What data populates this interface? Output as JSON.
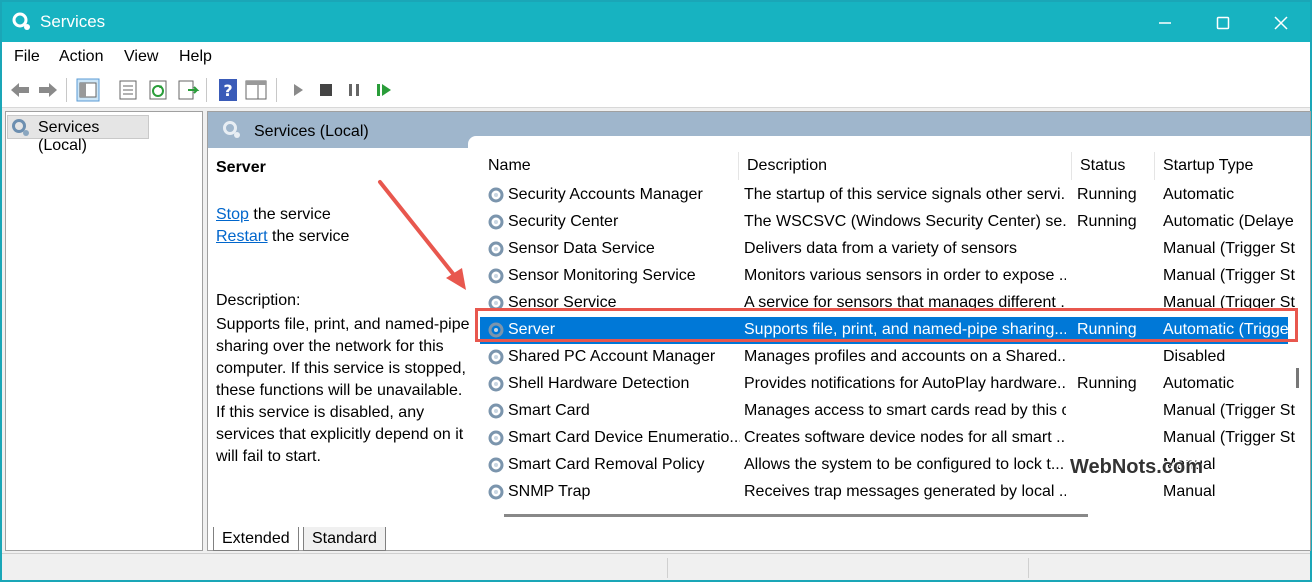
{
  "window": {
    "title": "Services"
  },
  "menu": [
    "File",
    "Action",
    "View",
    "Help"
  ],
  "tree": {
    "root_label": "Services (Local)"
  },
  "pane": {
    "title": "Services (Local)",
    "selected_service": "Server",
    "actions": [
      {
        "link": "Stop",
        "suffix": " the service"
      },
      {
        "link": "Restart",
        "suffix": " the service"
      }
    ],
    "description_label": "Description:",
    "description_text": "Supports file, print, and named-pipe sharing over the network for this computer. If this service is stopped, these functions will be unavailable. If this service is disabled, any services that explicitly depend on it will fail to start."
  },
  "columns": [
    "Name",
    "Description",
    "Status",
    "Startup Type"
  ],
  "rows": [
    {
      "name": "Security Accounts Manager",
      "description": "The startup of this service signals other servi...",
      "status": "Running",
      "startup": "Automatic"
    },
    {
      "name": "Security Center",
      "description": "The WSCSVC (Windows Security Center) se...",
      "status": "Running",
      "startup": "Automatic (Delaye"
    },
    {
      "name": "Sensor Data Service",
      "description": "Delivers data from a variety of sensors",
      "status": "",
      "startup": "Manual (Trigger St"
    },
    {
      "name": "Sensor Monitoring Service",
      "description": "Monitors various sensors in order to expose ...",
      "status": "",
      "startup": "Manual (Trigger St"
    },
    {
      "name": "Sensor Service",
      "description": "A service for sensors that manages different ...",
      "status": "",
      "startup": "Manual (Trigger St"
    },
    {
      "name": "Server",
      "description": "Supports file, print, and named-pipe sharing...",
      "status": "Running",
      "startup": "Automatic (Trigge"
    },
    {
      "name": "Shared PC Account Manager",
      "description": "Manages profiles and accounts on a Shared...",
      "status": "",
      "startup": "Disabled"
    },
    {
      "name": "Shell Hardware Detection",
      "description": "Provides notifications for AutoPlay hardware...",
      "status": "Running",
      "startup": "Automatic"
    },
    {
      "name": "Smart Card",
      "description": "Manages access to smart cards read by this c...",
      "status": "",
      "startup": "Manual (Trigger St"
    },
    {
      "name": "Smart Card Device Enumeratio...",
      "description": "Creates software device nodes for all smart ...",
      "status": "",
      "startup": "Manual (Trigger St"
    },
    {
      "name": "Smart Card Removal Policy",
      "description": "Allows the system to be configured to lock t...",
      "status": "",
      "startup": "Manual"
    },
    {
      "name": "SNMP Trap",
      "description": "Receives trap messages generated by local ...",
      "status": "",
      "startup": "Manual"
    }
  ],
  "selected_index": 5,
  "tabs": [
    "Extended",
    "Standard"
  ],
  "watermark": "WebNots.com",
  "colors": {
    "titlebar": "#17b3c1",
    "selection": "#0078d7",
    "highlight": "#e8574e",
    "link": "#0066cc"
  },
  "toolbar_icons": [
    "back-arrow-icon",
    "forward-arrow-icon",
    "show-hide-console-tree-icon",
    "properties-icon",
    "refresh-icon",
    "export-list-icon",
    "help-icon",
    "show-action-pane-icon",
    "start-service-icon",
    "stop-service-icon",
    "pause-service-icon",
    "resume-service-icon"
  ]
}
